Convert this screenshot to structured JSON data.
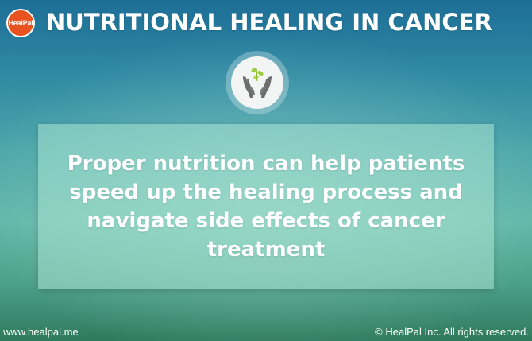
{
  "header": {
    "logo_text": "HealPal",
    "title": "NUTRITIONAL HEALING IN CANCER"
  },
  "emblem": {
    "icon": "hands-with-sprout-icon"
  },
  "card": {
    "message": "Proper nutrition can help patients speed up the healing process and navigate side effects of cancer treatment"
  },
  "footer": {
    "website": "www.healpal.me",
    "copyright": "© HealPal Inc. All rights reserved."
  },
  "colors": {
    "logo_orange": "#e8531f",
    "sprout_green": "#9ccc3c",
    "hands_gray": "#6d6d6d"
  }
}
